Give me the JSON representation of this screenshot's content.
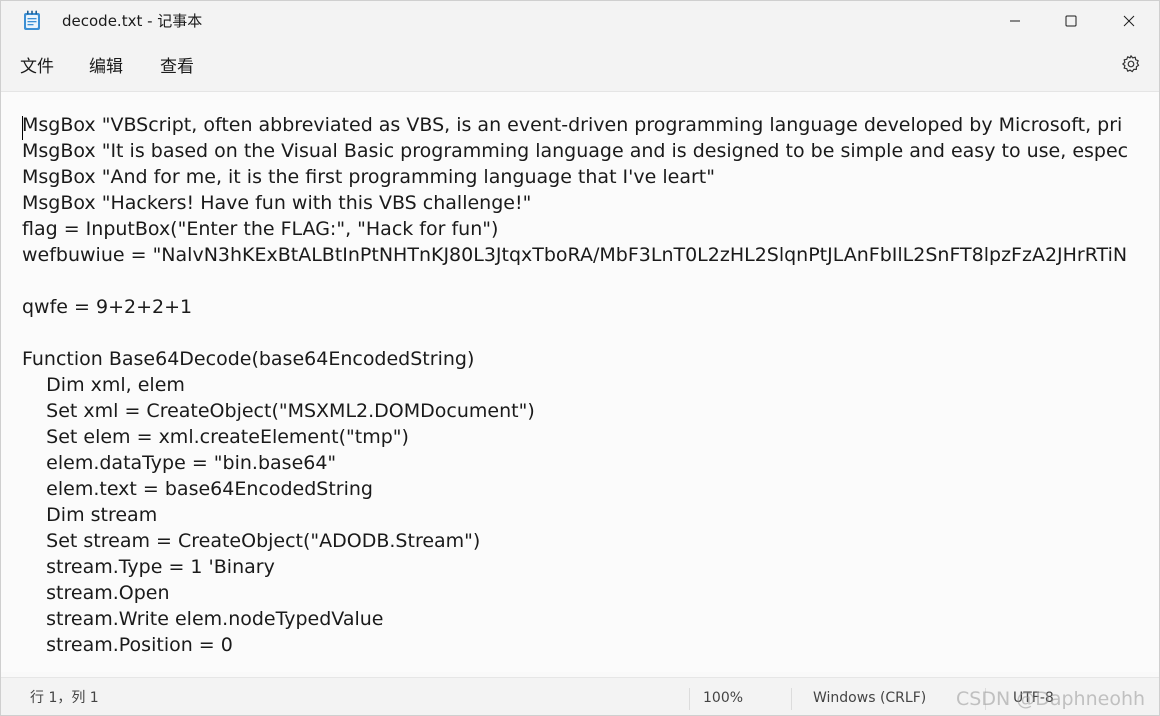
{
  "window": {
    "title": "decode.txt - 记事本"
  },
  "menu": {
    "file": "文件",
    "edit": "编辑",
    "view": "查看"
  },
  "editor": {
    "lines": [
      "MsgBox \"VBScript, often abbreviated as VBS, is an event-driven programming language developed by Microsoft, pri",
      "MsgBox \"It is based on the Visual Basic programming language and is designed to be simple and easy to use, espec",
      "MsgBox \"And for me, it is the first programming language that I've leart\"",
      "MsgBox \"Hackers! Have fun with this VBS challenge!\"",
      "flag = InputBox(\"Enter the FLAG:\", \"Hack for fun\")",
      "wefbuwiue = \"NalvN3hKExBtALBtInPtNHTnKJ80L3JtqxTboRA/MbF3LnT0L2zHL2SlqnPtJLAnFbIlL2SnFT8lpzFzA2JHrRTiN",
      "",
      "qwfe = 9+2+2+1",
      "",
      "Function Base64Decode(base64EncodedString)",
      "    Dim xml, elem",
      "    Set xml = CreateObject(\"MSXML2.DOMDocument\")",
      "    Set elem = xml.createElement(\"tmp\")",
      "    elem.dataType = \"bin.base64\"",
      "    elem.text = base64EncodedString",
      "    Dim stream",
      "    Set stream = CreateObject(\"ADODB.Stream\")",
      "    stream.Type = 1 'Binary",
      "    stream.Open",
      "    stream.Write elem.nodeTypedValue",
      "    stream.Position = 0"
    ]
  },
  "status": {
    "position": "行 1，列 1",
    "zoom": "100%",
    "line_ending": "Windows (CRLF)",
    "encoding": "UTF-8",
    "watermark": "CSDN @Daphneohh"
  },
  "icons": {
    "app": "notepad-icon",
    "minimize": "minimize-icon",
    "maximize": "maximize-icon",
    "close": "close-icon",
    "settings": "gear-icon"
  }
}
